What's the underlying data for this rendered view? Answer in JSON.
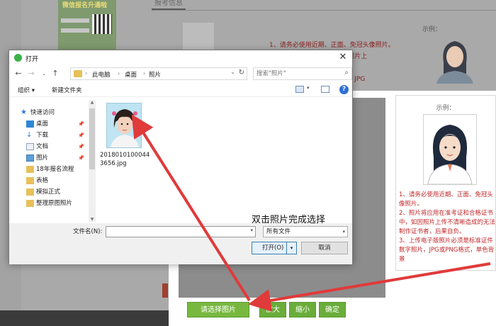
{
  "background": {
    "tab_label": "报考信息",
    "banner_text": "微信报名升通啦",
    "sample_label": "示例：",
    "instruction_lines": [
      "1、请务必使用近期、正面、免冠头像照片。",
      "                    证书中，如因照片上",
      "                    ，后果自负。",
      "                    证件数字照片，JPG"
    ]
  },
  "upload_panel": {
    "sample_title": "示例：",
    "sample_text": [
      "1、请务必使用近期、正面、免冠头像照片。",
      "2、照片将应用在准考证和合格证书中，如因照片上传不清晰造成的无法制作证书者，后果自负。",
      "3、上传电子版照片必须是标准证件数字照片，JPG或PNG格式，单色背景"
    ],
    "buttons": {
      "choose": "请选择图片",
      "zoom_in": "放大",
      "zoom_out": "缩小",
      "confirm": "确定"
    }
  },
  "dialog": {
    "title": "打开",
    "breadcrumb": [
      "此电脑",
      "桌面",
      "照片"
    ],
    "search_placeholder": "搜索\"照片\"",
    "toolbar": {
      "organize": "组织 ▾",
      "new_folder": "新建文件夹"
    },
    "sidebar": [
      {
        "label": "快速访问",
        "icon": "star-icon"
      },
      {
        "label": "桌面",
        "icon": "desktop-icon"
      },
      {
        "label": "下载",
        "icon": "download-icon"
      },
      {
        "label": "文档",
        "icon": "document-icon"
      },
      {
        "label": "图片",
        "icon": "pictures-icon"
      },
      {
        "label": "18年报名流程",
        "icon": "folder-icon"
      },
      {
        "label": "表格",
        "icon": "folder-icon"
      },
      {
        "label": "模拟正式",
        "icon": "folder-icon"
      },
      {
        "label": "整理原图照片",
        "icon": "folder-icon"
      }
    ],
    "file": {
      "name_line1": "2018010100044",
      "name_line2": "3656.jpg"
    },
    "instruction": "双击照片完成选择",
    "filename_label": "文件名(N):",
    "filetype": "所有文件",
    "open_label": "打开(O)",
    "cancel_label": "取消"
  },
  "colors": {
    "accent_green": "#78b83f",
    "arrow_red": "#e03a3a",
    "instruction_red": "#c0282b"
  }
}
